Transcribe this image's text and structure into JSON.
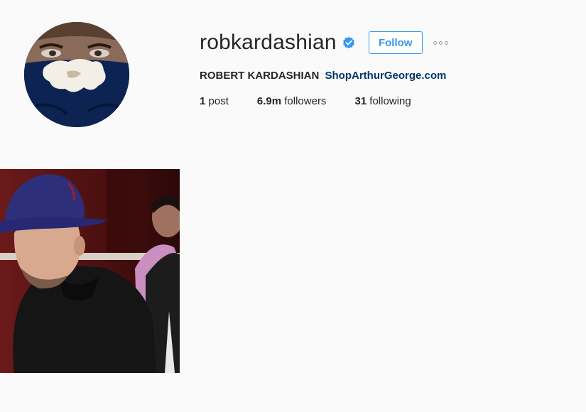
{
  "profile": {
    "username": "robkardashian",
    "verified": true,
    "follow_label": "Follow",
    "more_icon": "ellipsis-icon",
    "full_name": "ROBERT KARDASHIAN",
    "website": "ShopArthurGeorge.com"
  },
  "stats": {
    "posts_count": "1",
    "posts_label": "post",
    "followers_count": "6.9m",
    "followers_label": "followers",
    "following_count": "31",
    "following_label": "following"
  },
  "colors": {
    "accent": "#3897f0",
    "link": "#003569",
    "background": "#fafafa",
    "text": "#262626"
  },
  "posts": [
    {
      "icon": "post-photo"
    }
  ]
}
